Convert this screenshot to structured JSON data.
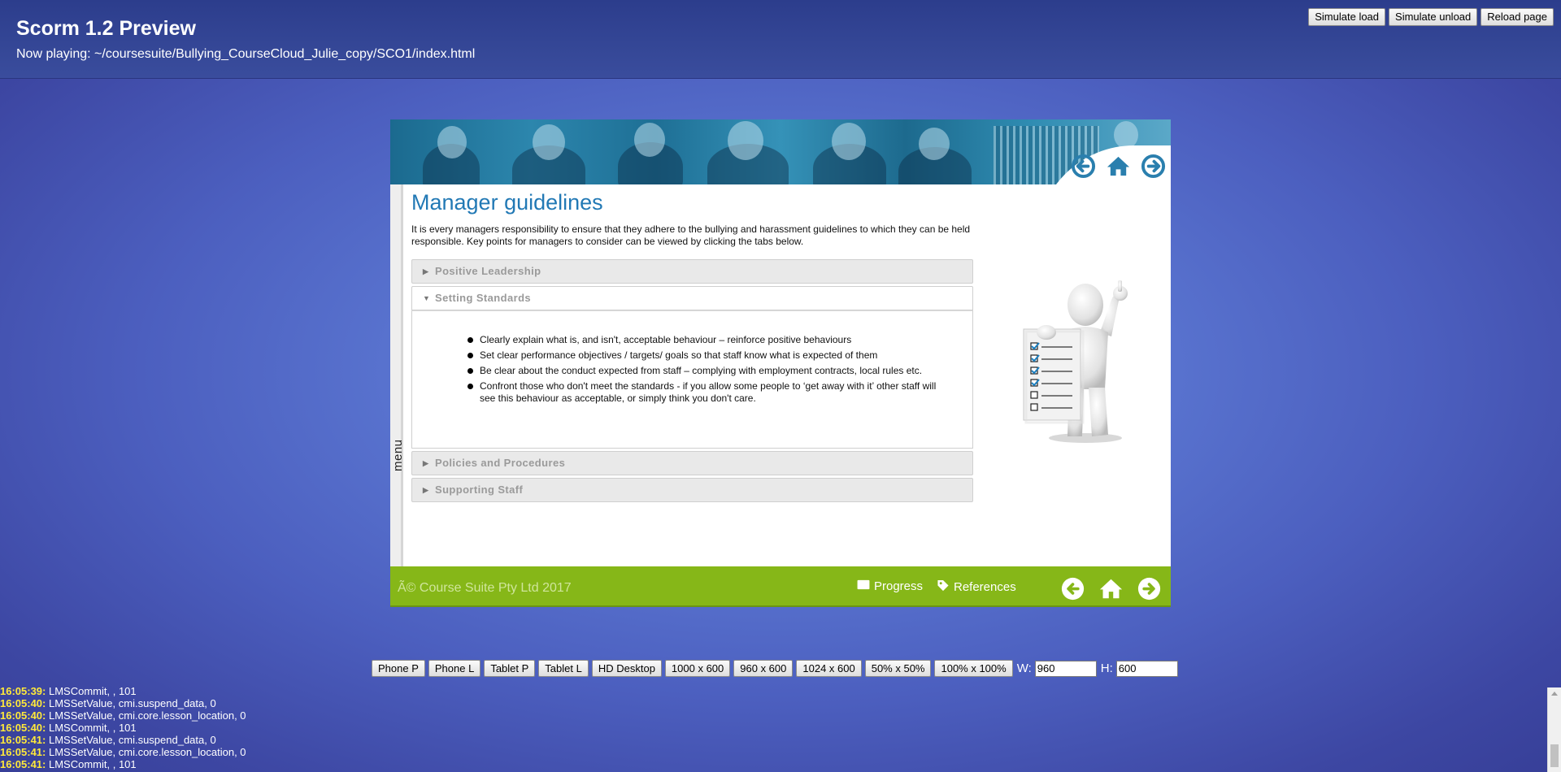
{
  "header": {
    "title": "Scorm 1.2 Preview",
    "now_playing": "Now playing: ~/coursesuite/Bullying_CourseCloud_Julie_copy/SCO1/index.html",
    "buttons": [
      "Simulate load",
      "Simulate unload",
      "Reload page"
    ]
  },
  "course": {
    "menu_label": "menu",
    "page_title": "Manager guidelines",
    "intro": "It is every managers responsibility to ensure that they adhere to the bullying and harassment guidelines to which they can be held responsible. Key points for managers to consider can be viewed by clicking the tabs below.",
    "accordion": [
      {
        "label": "Positive Leadership",
        "open": false
      },
      {
        "label": "Setting Standards",
        "open": true,
        "bullets": [
          "Clearly explain what is, and isn't, acceptable behaviour – reinforce positive behaviours",
          "Set clear performance objectives / targets/ goals so that staff know what is expected of them",
          "Be clear about the conduct expected from staff – complying with employment contracts, local rules etc.",
          "Confront those who don't meet the standards - if you allow some people to ‘get away with it’ other staff will see this behaviour as acceptable, or simply think you don't care."
        ]
      },
      {
        "label": "Policies and Procedures",
        "open": false
      },
      {
        "label": "Supporting Staff",
        "open": false
      }
    ],
    "footer": {
      "copyright": "Ã© Course Suite Pty Ltd 2017",
      "progress": "Progress",
      "references": "References"
    },
    "nav_icons": [
      "arrow-left-circle-icon",
      "home-icon",
      "arrow-right-circle-icon"
    ],
    "colors": {
      "title_blue": "#2279b5",
      "footer_green": "#86b718",
      "icon_blue": "#2a7fae"
    }
  },
  "size_bar": {
    "buttons": [
      "Phone P",
      "Phone L",
      "Tablet P",
      "Tablet L",
      "HD Desktop",
      "1000 x 600",
      "960 x 600",
      "1024 x 600",
      "50% x 50%",
      "100% x 100%"
    ],
    "w_label": "W:",
    "w_value": "960",
    "h_label": "H:",
    "h_value": "600"
  },
  "log": [
    {
      "time": "16:05:39:",
      "text": " LMSCommit, , 101"
    },
    {
      "time": "16:05:40:",
      "text": " LMSSetValue, cmi.suspend_data, 0"
    },
    {
      "time": "16:05:40:",
      "text": " LMSSetValue, cmi.core.lesson_location, 0"
    },
    {
      "time": "16:05:40:",
      "text": " LMSCommit, , 101"
    },
    {
      "time": "16:05:41:",
      "text": " LMSSetValue, cmi.suspend_data, 0"
    },
    {
      "time": "16:05:41:",
      "text": " LMSSetValue, cmi.core.lesson_location, 0"
    },
    {
      "time": "16:05:41:",
      "text": " LMSCommit, , 101"
    }
  ]
}
